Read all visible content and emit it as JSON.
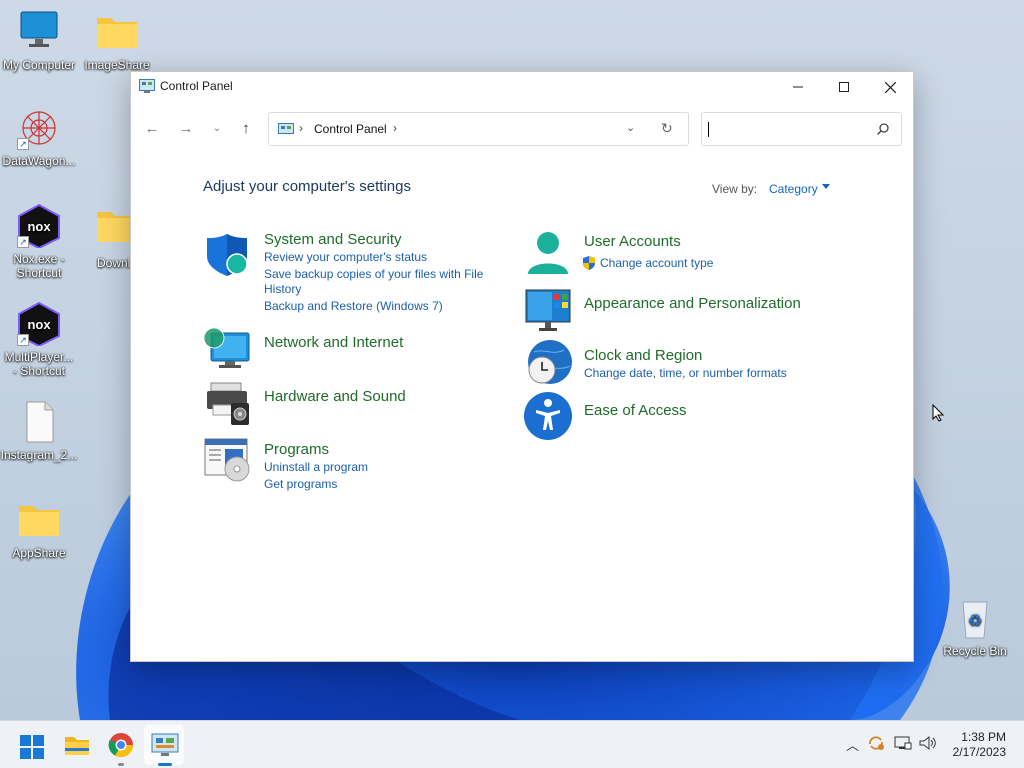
{
  "desktop": {
    "icons": [
      {
        "label": "My Computer"
      },
      {
        "label": "ImageShare"
      },
      {
        "label": "DataWagon..."
      },
      {
        "label": "Nox.exe -\nShortcut"
      },
      {
        "label": "Downlo"
      },
      {
        "label": "MultiPlayer...\n- Shortcut"
      },
      {
        "label": "Instagram_2..."
      },
      {
        "label": "AppShare"
      },
      {
        "label": "Recycle Bin"
      }
    ]
  },
  "window": {
    "title": "Control Panel",
    "address": {
      "crumb": "Control Panel"
    },
    "search": {
      "placeholder": ""
    },
    "heading": "Adjust your computer's settings",
    "view_by_label": "View by:",
    "view_by_value": "Category",
    "categories": [
      {
        "title": "System and Security",
        "links": [
          "Review your computer's status",
          "Save backup copies of your files with File",
          "History",
          "Backup and Restore (Windows 7)"
        ]
      },
      {
        "title": "Network and Internet",
        "links": []
      },
      {
        "title": "Hardware and Sound",
        "links": []
      },
      {
        "title": "Programs",
        "links": [
          "Uninstall a program",
          "Get programs"
        ]
      },
      {
        "title": "User Accounts",
        "links": [
          "Change account type"
        ]
      },
      {
        "title": "Appearance and Personalization",
        "links": []
      },
      {
        "title": "Clock and Region",
        "links": [
          "Change date, time, or number formats"
        ]
      },
      {
        "title": "Ease of Access",
        "links": []
      }
    ]
  },
  "taskbar": {
    "time": "1:38 PM",
    "date": "2/17/2023"
  },
  "colors": {
    "link": "#1c5fb0",
    "category_title": "#1f6b2a",
    "heading": "#1e3a63"
  }
}
